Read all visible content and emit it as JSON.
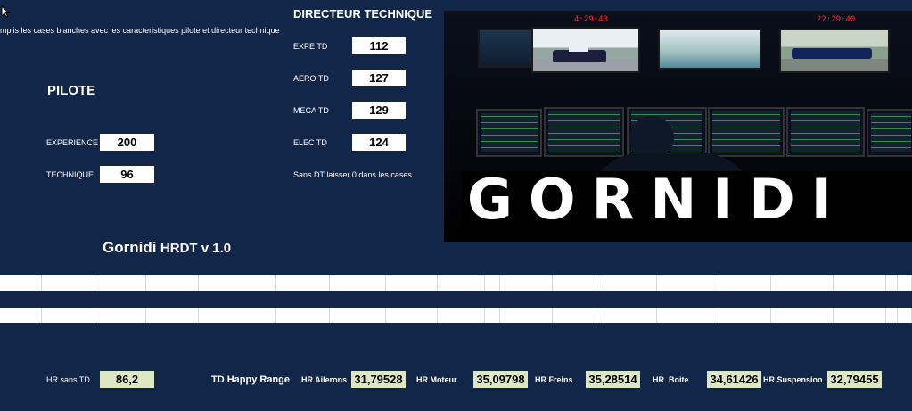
{
  "instruction": "mplis  les cases blanches avec les caracteristiques pilote et directeur technique",
  "directeur": {
    "title": "DIRECTEUR TECHNIQUE",
    "fields": [
      {
        "label": "EXPE TD",
        "value": "112"
      },
      {
        "label": "AERO TD",
        "value": "127"
      },
      {
        "label": "MECA TD",
        "value": "129"
      },
      {
        "label": "ELEC TD",
        "value": "124"
      }
    ],
    "note": "Sans DT laisser 0 dans les cases"
  },
  "pilote": {
    "title": "PILOTE",
    "fields": [
      {
        "label": "EXPERIENCE",
        "value": "200"
      },
      {
        "label": "TECHNIQUE",
        "value": "96"
      }
    ]
  },
  "app_title_main": "Gornidi",
  "app_title_rest": "HRDT v 1.0",
  "image": {
    "logo_text": "GORNIDI",
    "clock_1": "4:29:40",
    "clock_2": "22:29:40",
    "icon": "f1-control-room-photo"
  },
  "results": {
    "hr_sans_td_label": "HR sans TD",
    "hr_sans_td_value": "86,2",
    "td_happy_range_label": "TD Happy Range",
    "items": [
      {
        "label": "HR Ailerons",
        "value": "31,79528"
      },
      {
        "label": "HR Moteur",
        "value": "35,09798"
      },
      {
        "label": "HR Freins",
        "value": "35,28514"
      },
      {
        "label": "HR  Boite",
        "value": "34,61426"
      },
      {
        "label": "HR Suspension",
        "value": "32,79455"
      }
    ]
  },
  "colors": {
    "background": "#112648",
    "value_box": "#ffffff",
    "result_box": "#dde7c4"
  }
}
